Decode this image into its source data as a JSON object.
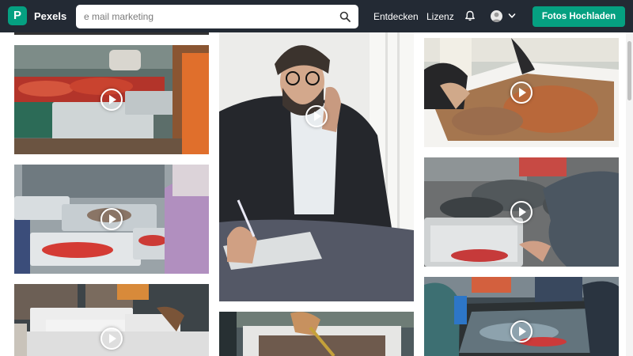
{
  "brand": {
    "name": "Pexels",
    "logo_letter": "P",
    "accent_color": "#05a081"
  },
  "search": {
    "value": "",
    "placeholder": "e mail marketing"
  },
  "nav": {
    "explore": "Entdecken",
    "license": "Lizenz",
    "upload": "Fotos Hochladen"
  },
  "header_color": "#232a34",
  "icons": [
    "search-icon",
    "bell-icon",
    "chevron-down-icon",
    "play-icon"
  ]
}
